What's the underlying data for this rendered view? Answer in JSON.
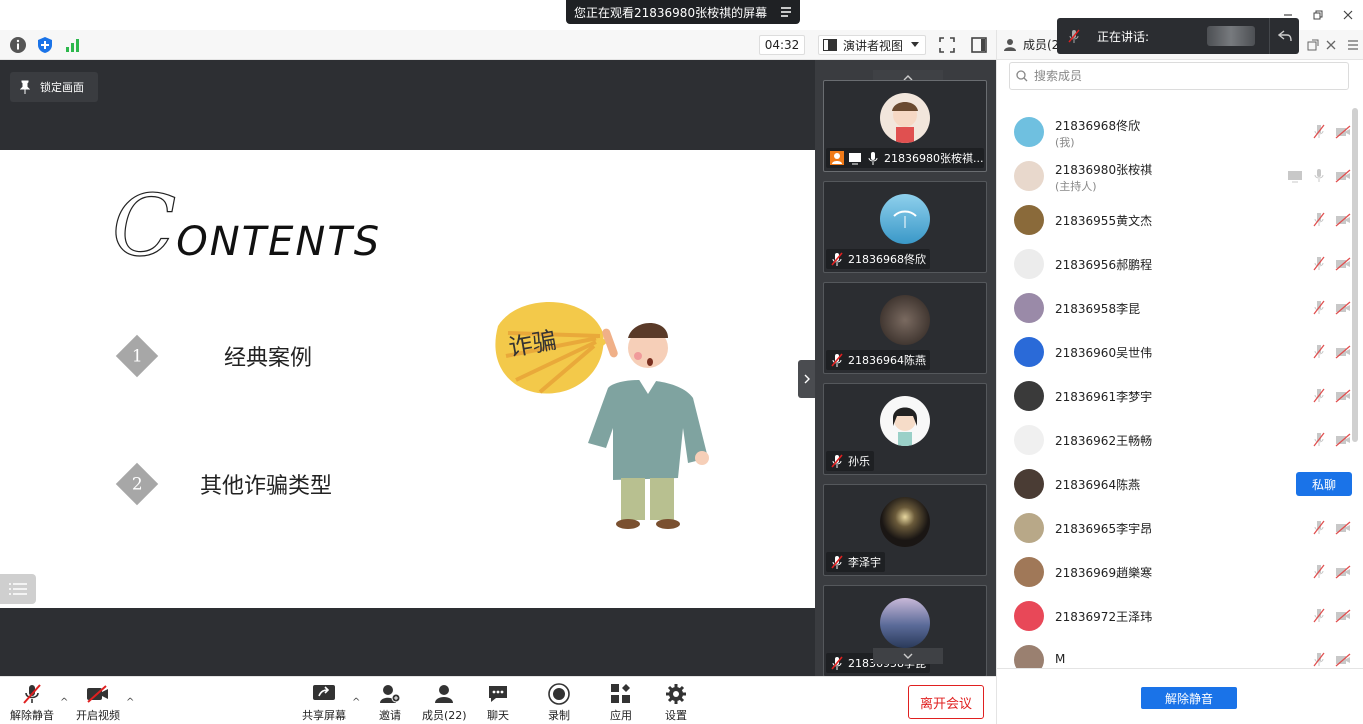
{
  "window": {
    "share_banner": "您正在观看21836980张桉祺的屏幕"
  },
  "toolbar": {
    "timer": "04:32",
    "view_label": "演讲者视图"
  },
  "stage": {
    "lock_label": "锁定画面",
    "slide": {
      "title_initial": "C",
      "title_rest": "ONTENTS",
      "items": [
        {
          "num": "1",
          "label": "经典案例"
        },
        {
          "num": "2",
          "label": "其他诈骗类型"
        }
      ],
      "bubble_text": "诈骗"
    }
  },
  "video_strip": {
    "tiles": [
      {
        "name": "21836980张桉祺...",
        "avatar_color": "#f2e6dc"
      },
      {
        "name": "21836968佟欣",
        "avatar_color": "#5fb4d8"
      },
      {
        "name": "21836964陈燕",
        "avatar_color": "#4a3c34"
      },
      {
        "name": "孙乐",
        "avatar_color": "#f3f3f3"
      },
      {
        "name": "李泽宇",
        "avatar_color": "#2a2420"
      },
      {
        "name": "21836958李昆",
        "avatar_color": "#8a7a9a"
      }
    ]
  },
  "panel": {
    "header_label": "成员(2",
    "speaking_label": "正在讲话:",
    "search_placeholder": "搜索成员",
    "chat_label": "私聊",
    "unmute_all_label": "解除静音",
    "members": [
      {
        "name": "21836968佟欣",
        "sub": "(我)",
        "color": "#6fc0e0"
      },
      {
        "name": "21836980张桉祺",
        "sub": "(主持人)",
        "color": "#e8d8cc"
      },
      {
        "name": "21836955黄文杰",
        "sub": "",
        "color": "#8a6a3a"
      },
      {
        "name": "21836956郝鹏程",
        "sub": "",
        "color": "#ececec"
      },
      {
        "name": "21836958李昆",
        "sub": "",
        "color": "#9a8aa8"
      },
      {
        "name": "21836960吴世伟",
        "sub": "",
        "color": "#2a6ad8"
      },
      {
        "name": "21836961李梦宇",
        "sub": "",
        "color": "#3a3a3a"
      },
      {
        "name": "21836962王畅畅",
        "sub": "",
        "color": "#f0f0f0"
      },
      {
        "name": "21836964陈燕",
        "sub": "",
        "color": "#4a3c34"
      },
      {
        "name": "21836965李宇昂",
        "sub": "",
        "color": "#b8a888"
      },
      {
        "name": "21836969趙樂寒",
        "sub": "",
        "color": "#a07858"
      },
      {
        "name": "21836972王泽玮",
        "sub": "",
        "color": "#e84858"
      },
      {
        "name": "M",
        "sub": "",
        "color": "#9a8070"
      }
    ]
  },
  "bottom": {
    "unmute": "解除静音",
    "video": "开启视频",
    "share": "共享屏幕",
    "invite": "邀请",
    "members": "成员(22)",
    "chat": "聊天",
    "record": "录制",
    "apps": "应用",
    "settings": "设置",
    "leave": "离开会议"
  },
  "colors": {
    "accent": "#1a73e8",
    "danger": "#e02020",
    "stage_bg": "#2d2f33"
  }
}
